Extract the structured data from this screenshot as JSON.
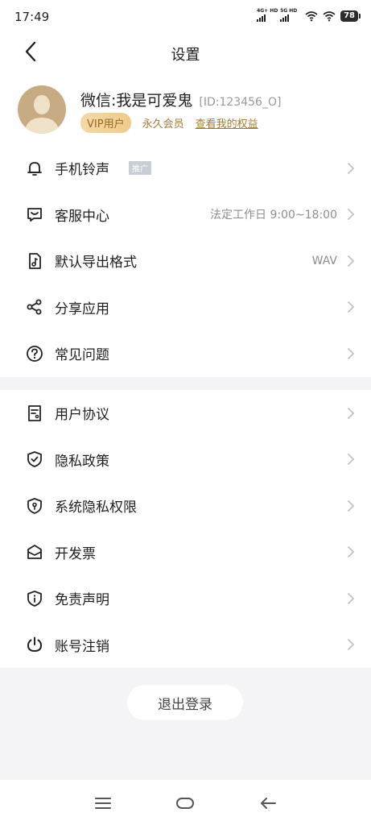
{
  "status": {
    "time": "17:49",
    "sim1": "4G+ HD",
    "sim2": "5G HD",
    "battery": "78"
  },
  "header": {
    "title": "设置"
  },
  "profile": {
    "name": "微信:我是可爱鬼",
    "id": "[ID:123456_O]",
    "vip_label": "VIP用户",
    "member_label": "永久会员",
    "rights_link": "查看我的权益"
  },
  "menu1": [
    {
      "label": "手机铃声",
      "tag": "推广",
      "icon": "bell-icon"
    },
    {
      "label": "客服中心",
      "value": "法定工作日 9:00~18:00",
      "icon": "chat-icon"
    },
    {
      "label": "默认导出格式",
      "value": "WAV",
      "icon": "music-file-icon"
    },
    {
      "label": "分享应用",
      "icon": "share-icon"
    },
    {
      "label": "常见问题",
      "icon": "question-icon"
    }
  ],
  "menu2": [
    {
      "label": "用户协议",
      "icon": "agreement-icon"
    },
    {
      "label": "隐私政策",
      "icon": "shield-check-icon"
    },
    {
      "label": "系统隐私权限",
      "icon": "shield-lock-icon"
    },
    {
      "label": "开发票",
      "icon": "invoice-icon"
    },
    {
      "label": "免责声明",
      "icon": "info-shield-icon"
    },
    {
      "label": "账号注销",
      "icon": "power-icon"
    }
  ],
  "logout": {
    "label": "退出登录"
  }
}
